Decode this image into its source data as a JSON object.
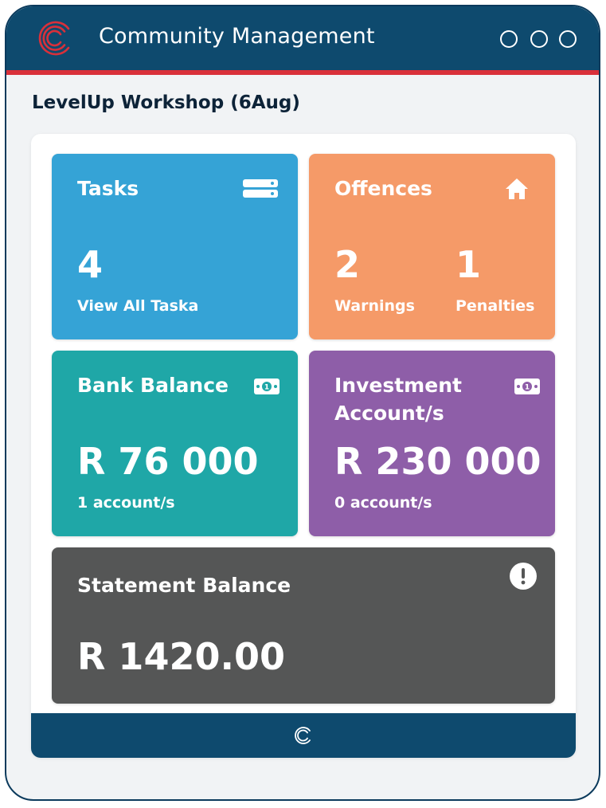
{
  "window": {
    "title": "Community Management",
    "logo_icon": "concentric-c-logo-icon",
    "controls": [
      "window-control-1",
      "window-control-2",
      "window-control-3"
    ]
  },
  "page": {
    "title": "LevelUp Workshop (6Aug)"
  },
  "cards": {
    "tasks": {
      "title": "Tasks",
      "count": "4",
      "link_label": "View All Taska",
      "icon": "stacked-bars-icon",
      "color": "#35a3d6"
    },
    "offences": {
      "title": "Offences",
      "warnings_count": "2",
      "warnings_label": "Warnings",
      "penalties_count": "1",
      "penalties_label": "Penalties",
      "icon": "home-icon",
      "color": "#f59a68"
    },
    "bank": {
      "title": "Bank Balance",
      "amount": "R 76 000",
      "accounts": "1 account/s",
      "icon": "banknote-icon",
      "color": "#1fa7a7"
    },
    "investment": {
      "title": "Investment\nAccount/s",
      "amount": "R 230 000",
      "accounts": "0 account/s",
      "icon": "banknote-icon",
      "color": "#8e5ea8"
    },
    "statement": {
      "title": "Statement Balance",
      "amount": "R 1420.00",
      "icon": "exclamation-circle-icon",
      "color": "#555656"
    }
  },
  "colors": {
    "titlebar": "#0e4a6e",
    "accent_stripe": "#d9303a",
    "page_bg": "#f1f3f5"
  },
  "footer": {
    "icon": "concentric-c-logo-icon"
  }
}
